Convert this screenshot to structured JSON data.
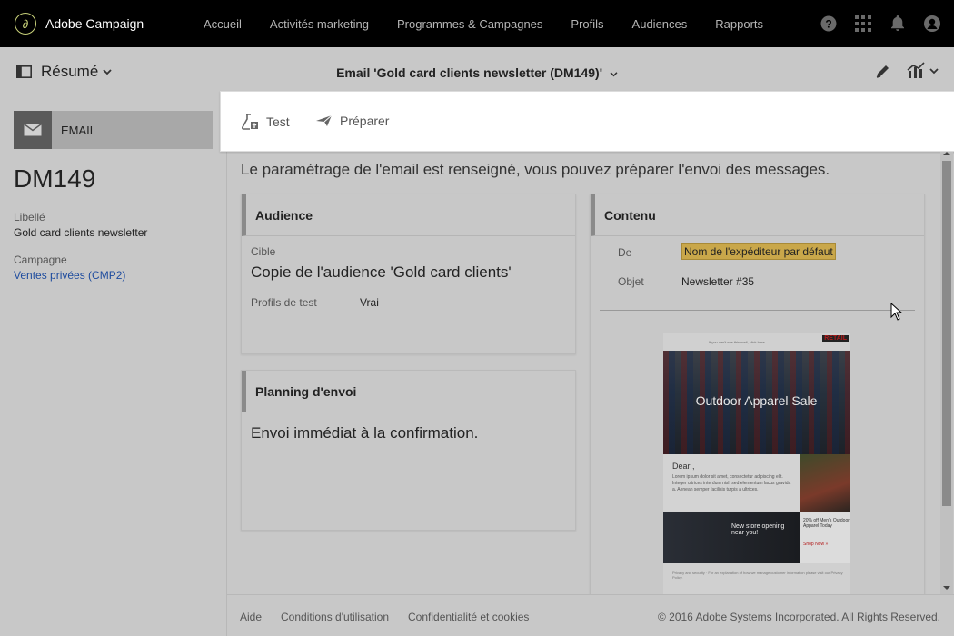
{
  "app": {
    "name": "Adobe Campaign",
    "logo_glyph": "∂"
  },
  "nav": {
    "items": [
      "Accueil",
      "Activités marketing",
      "Programmes & Campagnes",
      "Profils",
      "Audiences",
      "Rapports"
    ],
    "icons": [
      "help-icon",
      "apps-grid-icon",
      "bell-icon",
      "user-avatar-icon"
    ]
  },
  "subheader": {
    "view_label": "Résumé",
    "title": "Email 'Gold card clients newsletter (DM149)'"
  },
  "sidebar": {
    "type_label": "EMAIL",
    "code": "DM149",
    "label_caption": "Libellé",
    "label_value": "Gold card clients newsletter",
    "campaign_caption": "Campagne",
    "campaign_value": "Ventes privées (CMP2)"
  },
  "actions": {
    "test": "Test",
    "prepare": "Préparer"
  },
  "main": {
    "info": "Le paramétrage de l'email est renseigné, vous pouvez préparer l'envoi des messages.",
    "audience": {
      "title": "Audience",
      "target_caption": "Cible",
      "target_value": "Copie de l'audience 'Gold card clients'",
      "test_profiles_caption": "Profils de test",
      "test_profiles_value": "Vrai"
    },
    "schedule": {
      "title": "Planning d'envoi",
      "value": "Envoi immédiat à la confirmation."
    },
    "content": {
      "title": "Contenu",
      "from_caption": "De",
      "from_value": "Nom de l'expéditeur par défaut",
      "subject_caption": "Objet",
      "subject_value": "Newsletter #35"
    }
  },
  "preview": {
    "topline": "If you can't see this mail, click here.",
    "brand": "RETAIL",
    "hero": "Outdoor Apparel Sale",
    "greeting": "Dear ,",
    "lorem": "Lorem ipsum dolor sit amet, consectetur adipiscing elit. Integer ultrices interdum nisl, sed elementum lacus gravida a. Aenean semper facilisis turpis a ultrices.",
    "store": "New store opening near you!",
    "offer": "20% off Men's Outdoor Apparel Today",
    "shop": "Shop Now »",
    "footer": "Privacy and security · For an explanation of how we manage customer information please visit our Privacy Policy."
  },
  "footer": {
    "help": "Aide",
    "terms": "Conditions d'utilisation",
    "privacy": "Confidentialité et cookies",
    "copyright": "© 2016 Adobe Systems Incorporated. All Rights Reserved."
  },
  "colors": {
    "highlight": "#c9a74a",
    "link": "#1d4b9e",
    "topbar": "#000000"
  }
}
